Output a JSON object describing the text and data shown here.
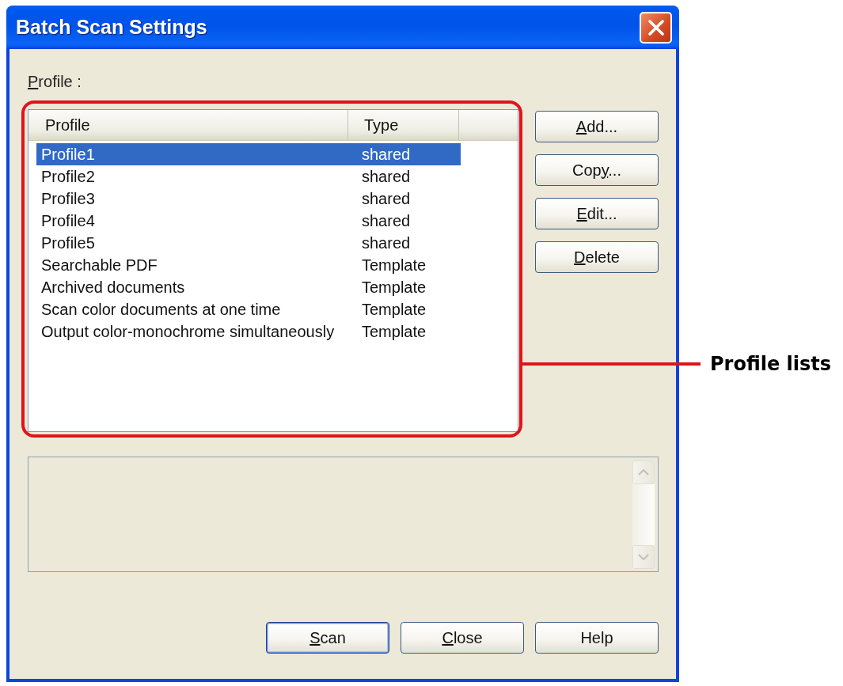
{
  "window": {
    "title": "Batch Scan Settings"
  },
  "profile_label": {
    "access_key": "P",
    "text_after": "rofile :"
  },
  "profile_list": {
    "columns": [
      "Profile",
      "Type"
    ],
    "rows": [
      {
        "profile": "Profile1",
        "type": "shared",
        "selected": true
      },
      {
        "profile": "Profile2",
        "type": "shared",
        "selected": false
      },
      {
        "profile": "Profile3",
        "type": "shared",
        "selected": false
      },
      {
        "profile": "Profile4",
        "type": "shared",
        "selected": false
      },
      {
        "profile": "Profile5",
        "type": "shared",
        "selected": false
      },
      {
        "profile": "Searchable PDF",
        "type": "Template",
        "selected": false
      },
      {
        "profile": "Archived documents",
        "type": "Template",
        "selected": false
      },
      {
        "profile": "Scan color documents at one time",
        "type": "Template",
        "selected": false
      },
      {
        "profile": "Output color-monochrome simultaneously",
        "type": "Template",
        "selected": false
      }
    ]
  },
  "side_buttons": [
    {
      "access_key": "A",
      "text_after": "dd..."
    },
    {
      "text_before": "Cop",
      "access_key": "y",
      "text_after": "..."
    },
    {
      "access_key": "E",
      "text_after": "dit..."
    },
    {
      "access_key": "D",
      "text_after": "elete"
    }
  ],
  "details_box": {
    "disabled": true
  },
  "bottom_buttons": [
    {
      "access_key": "S",
      "text_after": "can",
      "default": true
    },
    {
      "access_key": "C",
      "text_after": "lose",
      "default": false
    },
    {
      "text_before": "Help",
      "default": false
    }
  ],
  "callout": {
    "label": "Profile lists"
  }
}
